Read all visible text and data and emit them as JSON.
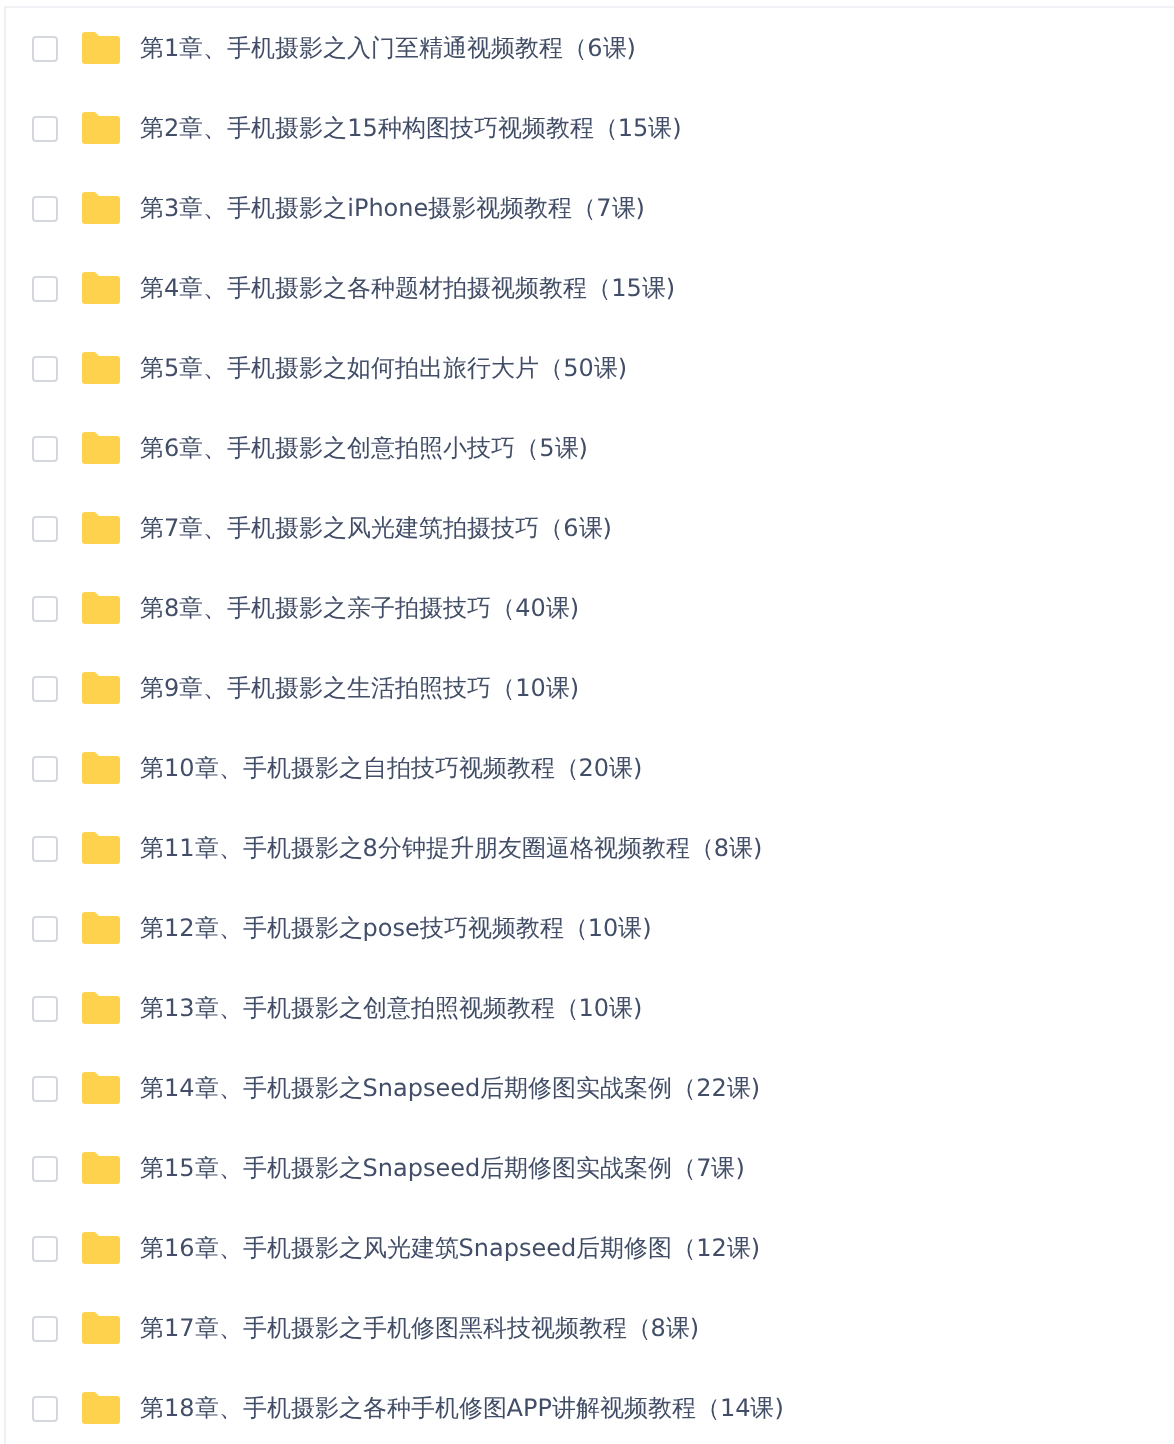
{
  "folders": [
    {
      "name": "第1章、手机摄影之入门至精通视频教程（6课)",
      "checked": false
    },
    {
      "name": "第2章、手机摄影之15种构图技巧视频教程（15课)",
      "checked": false
    },
    {
      "name": "第3章、手机摄影之iPhone摄影视频教程（7课)",
      "checked": false
    },
    {
      "name": "第4章、手机摄影之各种题材拍摄视频教程（15课)",
      "checked": false
    },
    {
      "name": "第5章、手机摄影之如何拍出旅行大片（50课)",
      "checked": false
    },
    {
      "name": "第6章、手机摄影之创意拍照小技巧（5课)",
      "checked": false
    },
    {
      "name": "第7章、手机摄影之风光建筑拍摄技巧（6课)",
      "checked": false
    },
    {
      "name": "第8章、手机摄影之亲子拍摄技巧（40课)",
      "checked": false
    },
    {
      "name": "第9章、手机摄影之生活拍照技巧（10课)",
      "checked": false
    },
    {
      "name": "第10章、手机摄影之自拍技巧视频教程（20课)",
      "checked": false
    },
    {
      "name": "第11章、手机摄影之8分钟提升朋友圈逼格视频教程（8课)",
      "checked": false
    },
    {
      "name": "第12章、手机摄影之pose技巧视频教程（10课)",
      "checked": false
    },
    {
      "name": "第13章、手机摄影之创意拍照视频教程（10课)",
      "checked": false
    },
    {
      "name": "第14章、手机摄影之Snapseed后期修图实战案例（22课)",
      "checked": false
    },
    {
      "name": "第15章、手机摄影之Snapseed后期修图实战案例（7课)",
      "checked": false
    },
    {
      "name": "第16章、手机摄影之风光建筑Snapseed后期修图（12课)",
      "checked": false
    },
    {
      "name": "第17章、手机摄影之手机修图黑科技视频教程（8课)",
      "checked": false
    },
    {
      "name": "第18章、手机摄影之各种手机修图APP讲解视频教程（14课)",
      "checked": false
    }
  ]
}
